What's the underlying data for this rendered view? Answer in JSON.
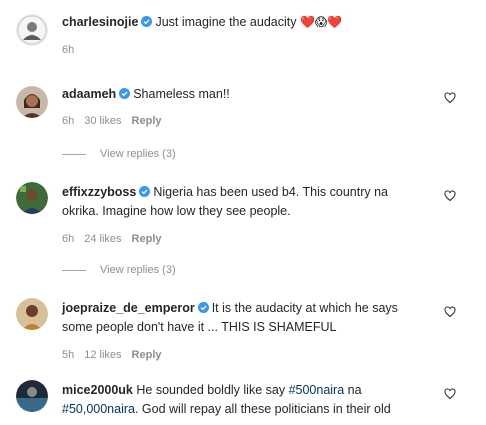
{
  "comments": [
    {
      "username": "charlesinojie",
      "verified": true,
      "text": "Just imagine the audacity",
      "emoji": "❤️😱❤️",
      "time": "6h",
      "likes": "",
      "reply": ""
    },
    {
      "username": "adaameh",
      "verified": true,
      "text": "Shameless man!!",
      "time": "6h",
      "likes": "30 likes",
      "reply": "Reply",
      "view_replies": "View replies (3)"
    },
    {
      "username": "effixzzyboss",
      "verified": true,
      "text_line1": "Nigeria has been used b4. This country na",
      "text_line2": "okrika. Imagine how low they see people.",
      "time": "6h",
      "likes": "24 likes",
      "reply": "Reply",
      "view_replies": "View replies (3)"
    },
    {
      "username": "joepraize_de_emperor",
      "verified": true,
      "text_line1": "It is the audacity at which he says",
      "text_line2": "some people don't have it ... THIS IS SHAMEFUL",
      "time": "5h",
      "likes": "12 likes",
      "reply": "Reply"
    },
    {
      "username": "mice2000uk",
      "verified": false,
      "text_line1_a": "He sounded boldly like say",
      "hashtag1": "#500naira",
      "text_line1_b": "na",
      "hashtag2": "#50,000naira",
      "text_line2": ". God will repay all these politicians in their old"
    }
  ],
  "colors": {
    "text": "#262626",
    "secondary": "#8e8e8e",
    "verified": "#3897f0",
    "hashtag": "#00376b"
  }
}
